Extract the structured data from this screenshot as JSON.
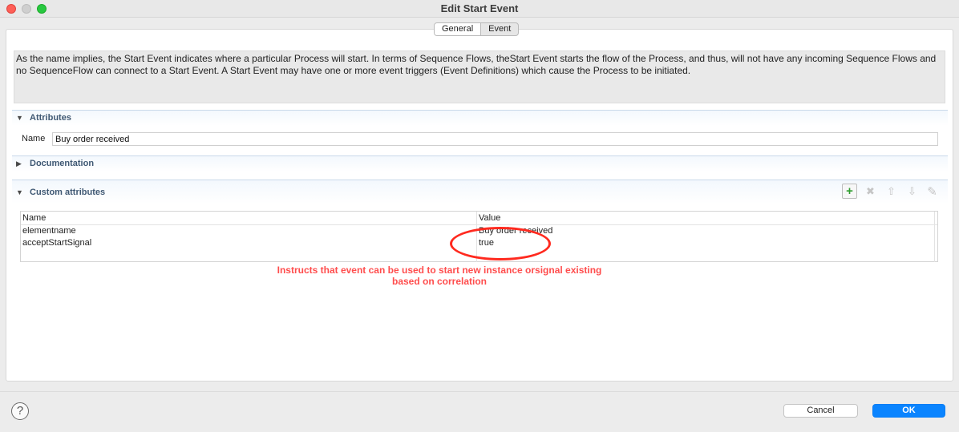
{
  "window": {
    "title": "Edit Start Event"
  },
  "tabs": [
    {
      "label": "General"
    },
    {
      "label": "Event"
    }
  ],
  "description": "As the name implies, the Start Event indicates where a particular Process will start. In terms of Sequence Flows, theStart Event starts the flow of the Process, and thus, will not have any incoming Sequence Flows and no SequenceFlow can connect to a Start Event. A Start Event may have one or more event triggers (Event Definitions) which cause the Process to be initiated.",
  "sections": {
    "attributes": "Attributes",
    "documentation": "Documentation",
    "custom_attributes": "Custom attributes"
  },
  "attributes": {
    "name_label": "Name",
    "name_value": "Buy order received"
  },
  "custom_table": {
    "columns": [
      "Name",
      "Value"
    ],
    "rows": [
      {
        "name": "elementname",
        "value": "Buy order received"
      },
      {
        "name": "acceptStartSignal",
        "value": "true"
      }
    ]
  },
  "annotation": {
    "line1": "Instructs that event can be used to start new instance orsignal existing",
    "line2": "based on correlation",
    "color": "#ff4d4d"
  },
  "footer": {
    "help_glyph": "?",
    "cancel_label": "Cancel",
    "ok_label": "OK"
  },
  "colors": {
    "ok_button": "#0a84ff",
    "annotation_circle": "#ff2a1f",
    "section_label": "#3f5873"
  }
}
